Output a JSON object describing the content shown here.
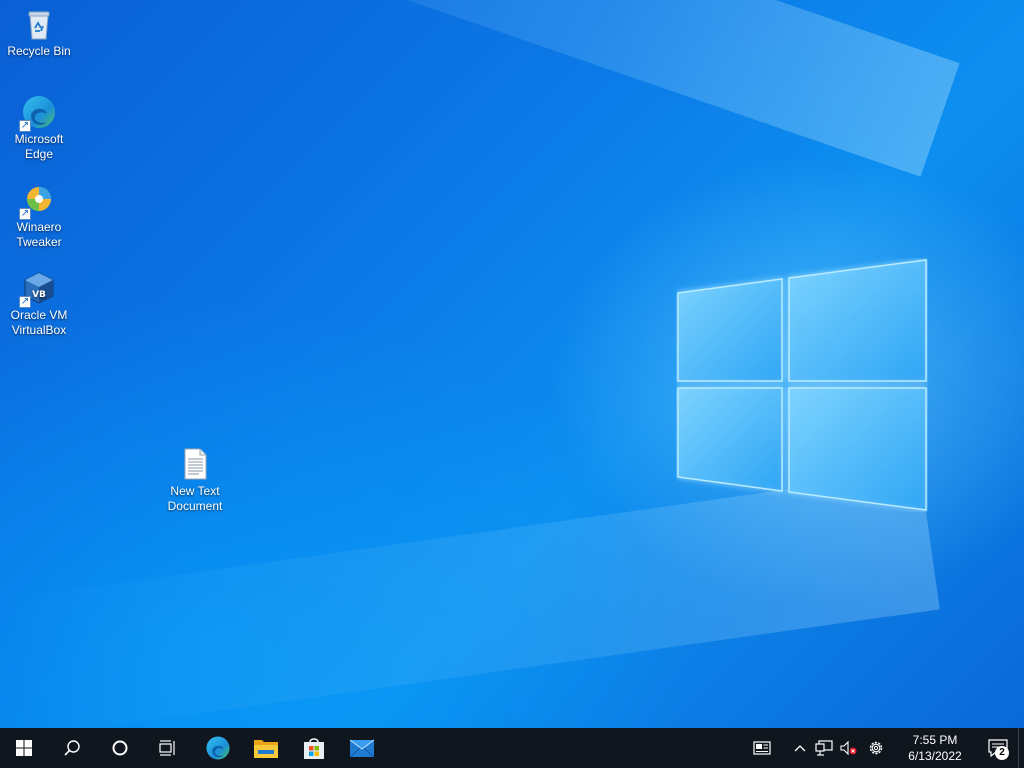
{
  "desktop": {
    "icons": [
      {
        "label": "Recycle Bin",
        "icon": "recycle-bin-icon"
      },
      {
        "label": "Microsoft Edge",
        "icon": "edge-icon"
      },
      {
        "label": "Winaero Tweaker",
        "icon": "winaero-tweaker-icon"
      },
      {
        "label": "Oracle VM VirtualBox",
        "icon": "virtualbox-icon"
      },
      {
        "label": "New Text Document",
        "icon": "text-document-icon"
      }
    ]
  },
  "taskbar": {
    "start": {
      "icon": "windows-start-icon"
    },
    "search": {
      "icon": "search-icon"
    },
    "cortana": {
      "icon": "cortana-circle-icon"
    },
    "task_view": {
      "icon": "task-view-icon"
    },
    "pinned_apps": [
      {
        "icon": "edge-icon"
      },
      {
        "icon": "file-explorer-icon"
      },
      {
        "icon": "microsoft-store-icon"
      },
      {
        "icon": "mail-icon"
      }
    ],
    "tray": {
      "news_icon": "news-and-interests-icon",
      "overflow_icon": "chevron-up-icon",
      "network_icon": "network-icon",
      "volume_icon": "volume-muted-icon",
      "settings_icon": "gear-icon",
      "time": "7:55 PM",
      "date": "6/13/2022",
      "notification_count": "2"
    }
  },
  "colors": {
    "taskbar_bg": "#10161e",
    "desktop_accent": "#0b78e6"
  }
}
